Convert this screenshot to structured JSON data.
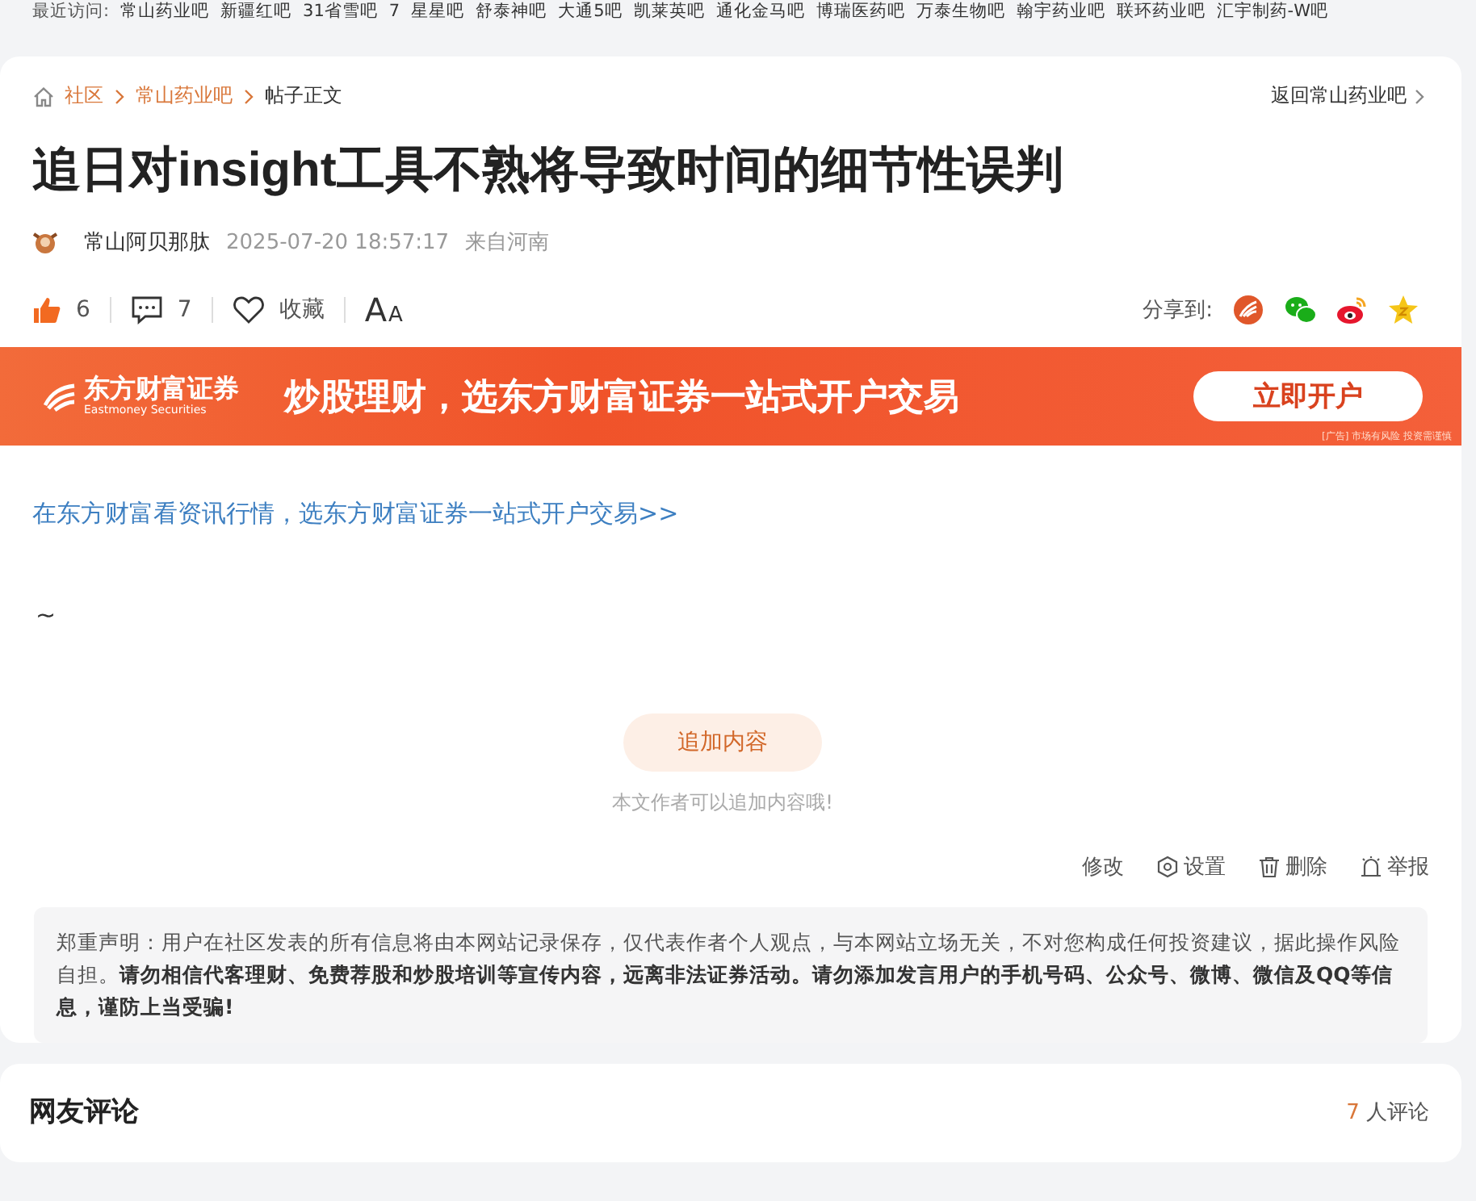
{
  "recent_visits": {
    "label": "最近访问:",
    "items": [
      "常山药业吧",
      "新疆红吧",
      "31省雪吧",
      "7",
      "星星吧",
      "舒泰神吧",
      "大通5吧",
      "凯莱英吧",
      "通化金马吧",
      "博瑞医药吧",
      "万泰生物吧",
      "翰宇药业吧",
      "联环药业吧",
      "汇宇制药-W吧"
    ]
  },
  "breadcrumb": [
    "社区",
    "常山药业吧",
    "帖子正文"
  ],
  "back_link": "返回常山药业吧",
  "title": "追日对insight工具不熟将导致时间的细节性误判",
  "author": {
    "name": "常山阿贝那肽",
    "time": "2025-07-20 18:57:17",
    "location": "来自河南"
  },
  "stats": {
    "likes": "6",
    "comments": "7",
    "favorite": "收藏",
    "font_size_big": "A",
    "font_size_small": "A"
  },
  "share": {
    "label": "分享到:"
  },
  "banner": {
    "brand": "东方财富证券",
    "brand_en": "Eastmoney Securities",
    "slogan": "炒股理财，选东方财富证券一站式开户交易",
    "button": "立即开户",
    "note": "[广告] 市场有风险 投资需谨慎"
  },
  "promo_link": "在东方财富看资讯行情，选东方财富证券一站式开户交易>>",
  "body": "~",
  "append": {
    "button": "追加内容",
    "hint": "本文作者可以追加内容哦!"
  },
  "post_actions": [
    "修改",
    "设置",
    "删除",
    "举报"
  ],
  "disclaimer": "郑重声明：用户在社区发表的所有信息将由本网站记录保存，仅代表作者个人观点，与本网站立场无关，不对您构成任何投资建议，据此操作风险自担。**请勿相信代客理财、免费荐股和炒股培训等宣传内容，远离非法证券活动。请勿添加发言用户的手机号码、公众号、微博、微信及QQ等信息，谨防上当受骗!**",
  "comments_section": {
    "title": "网友评论",
    "count": "7",
    "count_suffix": "人评论"
  }
}
